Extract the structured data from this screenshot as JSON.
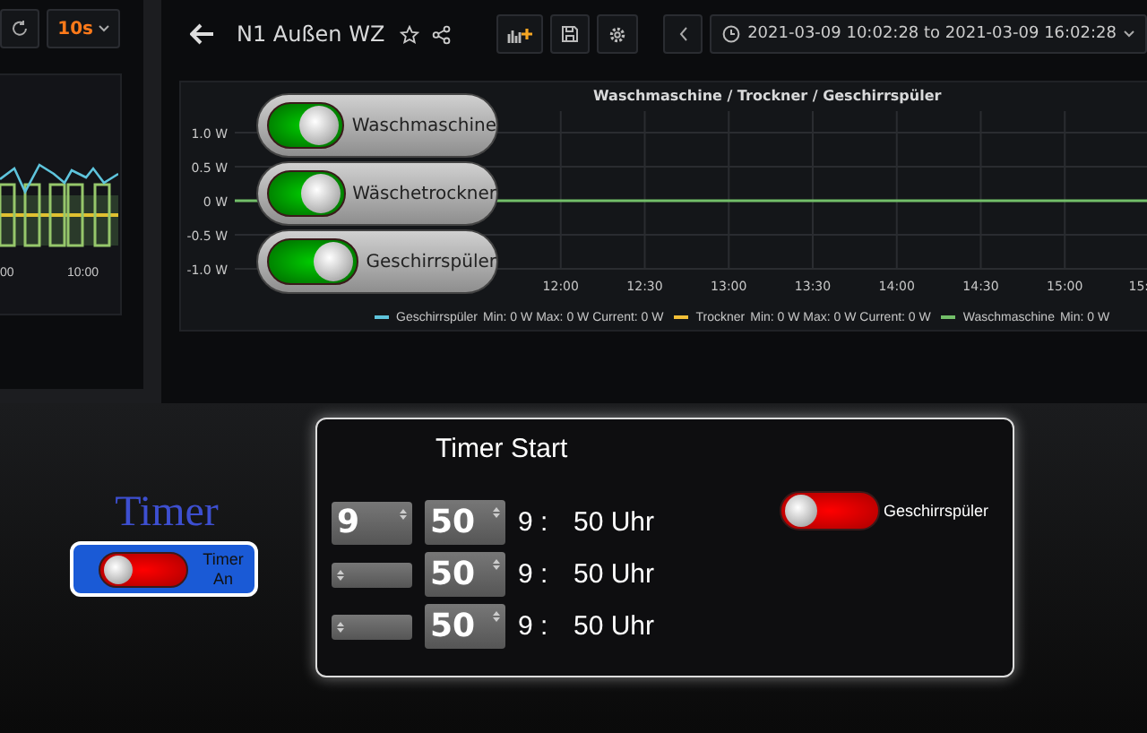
{
  "left_panel": {
    "refresh_interval": "10s",
    "x_labels": [
      "00",
      "10:00"
    ]
  },
  "dashboard": {
    "title": "N1 Außen WZ",
    "time_range": "2021-03-09 10:02:28 to 2021-03-09 16:02:28",
    "panel": {
      "title": "Waschmaschine / Trockner / Geschirrspüler",
      "chart_data": {
        "type": "line",
        "grid": true,
        "x": [
          10.06,
          15.5
        ],
        "xlim": [
          10.06,
          15.5
        ],
        "ylim": [
          -1,
          1
        ],
        "xticks": [
          {
            "value": 12,
            "label": "12:00"
          },
          {
            "value": 12.5,
            "label": "12:30"
          },
          {
            "value": 13,
            "label": "13:00"
          },
          {
            "value": 13.5,
            "label": "13:30"
          },
          {
            "value": 14,
            "label": "14:00"
          },
          {
            "value": 14.5,
            "label": "14:30"
          },
          {
            "value": 15,
            "label": "15:00"
          },
          {
            "value": 15.5,
            "label": "15:"
          }
        ],
        "yticks": [
          {
            "value": 1,
            "label": "1.0 W"
          },
          {
            "value": 0.5,
            "label": "0.5 W"
          },
          {
            "value": 0,
            "label": "0 W"
          },
          {
            "value": -0.5,
            "label": "-0.5 W"
          },
          {
            "value": -1,
            "label": "-1.0 W"
          }
        ],
        "series": [
          {
            "name": "Geschirrspüler",
            "color": "#5ec4dc",
            "values": [
              null,
              null
            ]
          },
          {
            "name": "Trockner",
            "color": "#f2c037",
            "values": [
              null,
              null
            ]
          },
          {
            "name": "Waschmaschine",
            "color": "#73bf69",
            "values": [
              0,
              0
            ]
          }
        ]
      },
      "legend_stats": [
        "Min: 0 W  Max: 0 W  Current: 0 W",
        "Min: 0 W  Max: 0 W  Current: 0 W",
        "Min: 0 W"
      ]
    }
  },
  "device_switches": [
    {
      "label": "Waschmaschine",
      "on": true
    },
    {
      "label": "Wäschetrockner",
      "on": true
    },
    {
      "label": "Geschirrspüler",
      "on": true
    }
  ],
  "timer": {
    "label": "Timer",
    "switch": {
      "label": "Timer An",
      "on": false
    }
  },
  "timer_start": {
    "title": "Timer Start",
    "rows": [
      {
        "hour": "9",
        "minute": "50",
        "hour_text": "9 :",
        "minute_text": "50 Uhr"
      },
      {
        "hour": "",
        "minute": "50",
        "hour_text": "9 :",
        "minute_text": "50 Uhr"
      },
      {
        "hour": "",
        "minute": "50",
        "hour_text": "9 :",
        "minute_text": "50 Uhr"
      }
    ],
    "switch": {
      "label": "Geschirrspüler",
      "on": false
    }
  }
}
